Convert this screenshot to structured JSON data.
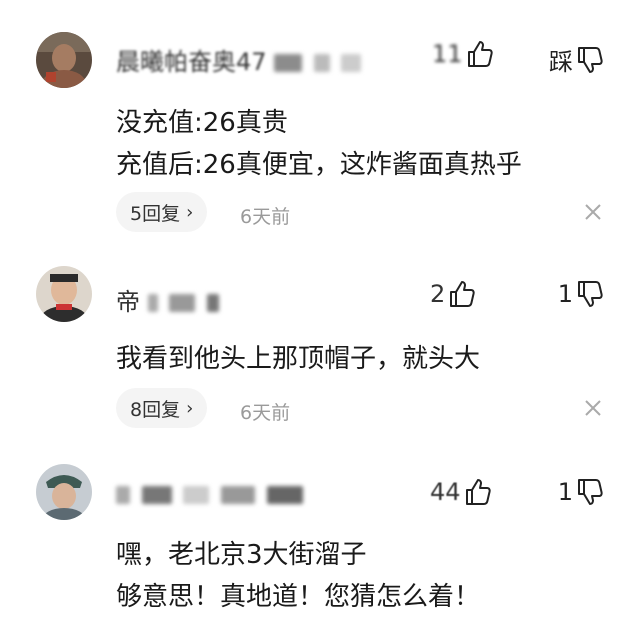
{
  "comments": [
    {
      "username": "晨曦帕奋奥47",
      "like_count": "11",
      "dislike_label": "踩",
      "lines": [
        "没充值:26真贵",
        "充值后:26真便宜，这炸酱面真热乎"
      ],
      "reply_label": "5回复",
      "time": "6天前"
    },
    {
      "username": "帝",
      "like_count": "2",
      "dislike_label": "1",
      "lines": [
        "我看到他头上那顶帽子，就头大"
      ],
      "reply_label": "8回复",
      "time": "6天前"
    },
    {
      "username": "",
      "like_count": "44",
      "dislike_label": "1",
      "lines": [
        "嘿，老北京3大街溜子",
        "够意思！真地道！您猜怎么着！"
      ]
    }
  ],
  "icons": {
    "like": "thumbs-up-icon",
    "dislike": "thumbs-down-icon",
    "close": "close-icon",
    "chevron": "chevron-right-icon"
  },
  "colors": {
    "text": "#1a1a1a",
    "muted": "#9a9a9a",
    "pill_bg": "#f4f4f4"
  }
}
